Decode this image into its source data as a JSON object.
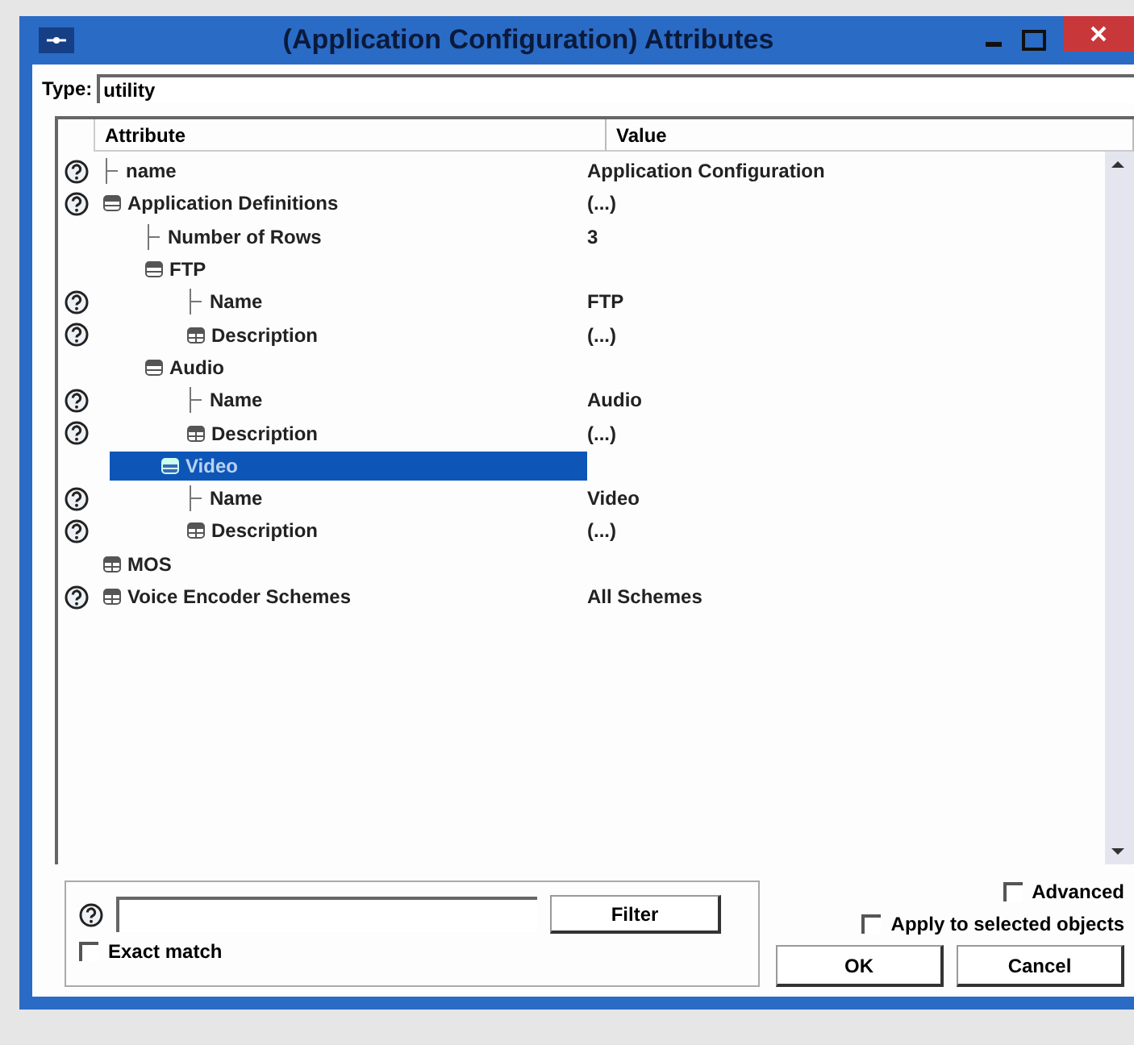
{
  "window": {
    "title": "(Application Configuration) Attributes"
  },
  "type_field": {
    "label": "Type:",
    "value": "utility"
  },
  "table": {
    "columns": [
      "Attribute",
      "Value"
    ],
    "rows": [
      {
        "label": "name",
        "help": true,
        "value": "Application Configuration",
        "selected": false
      },
      {
        "label": "Application Definitions",
        "help": true,
        "value": "(...)",
        "expanded": true,
        "selected": false,
        "children": [
          {
            "label": "Number of Rows",
            "help": false,
            "value": "3",
            "selected": false
          },
          {
            "label": "FTP",
            "help": false,
            "expanded": true,
            "selected": false,
            "children": [
              {
                "label": "Name",
                "help": true,
                "value": "FTP",
                "selected": false
              },
              {
                "label": "Description",
                "help": true,
                "value": "(...)",
                "expanded": false,
                "selected": false
              }
            ]
          },
          {
            "label": "Audio",
            "help": false,
            "expanded": true,
            "selected": false,
            "children": [
              {
                "label": "Name",
                "help": true,
                "value": "Audio",
                "selected": false
              },
              {
                "label": "Description",
                "help": true,
                "value": "(...)",
                "expanded": false,
                "selected": false
              }
            ]
          },
          {
            "label": "Video",
            "help": false,
            "expanded": true,
            "selected": true,
            "children": [
              {
                "label": "Name",
                "help": true,
                "value": "Video",
                "selected": false
              },
              {
                "label": "Description",
                "help": true,
                "value": "(...)",
                "expanded": false,
                "selected": false
              }
            ]
          }
        ]
      },
      {
        "label": "MOS",
        "help": false,
        "expanded": false,
        "selected": false
      },
      {
        "label": "Voice Encoder Schemes",
        "help": true,
        "value": "All Schemes",
        "expanded": false,
        "selected": false
      }
    ]
  },
  "filter": {
    "button": "Filter",
    "exact_match": {
      "label": "Exact match",
      "checked": false
    }
  },
  "advanced": {
    "label": "Advanced",
    "checked": false
  },
  "apply_selected": {
    "label": "Apply to selected objects",
    "checked": false
  },
  "buttons": [
    "OK",
    "Cancel"
  ]
}
